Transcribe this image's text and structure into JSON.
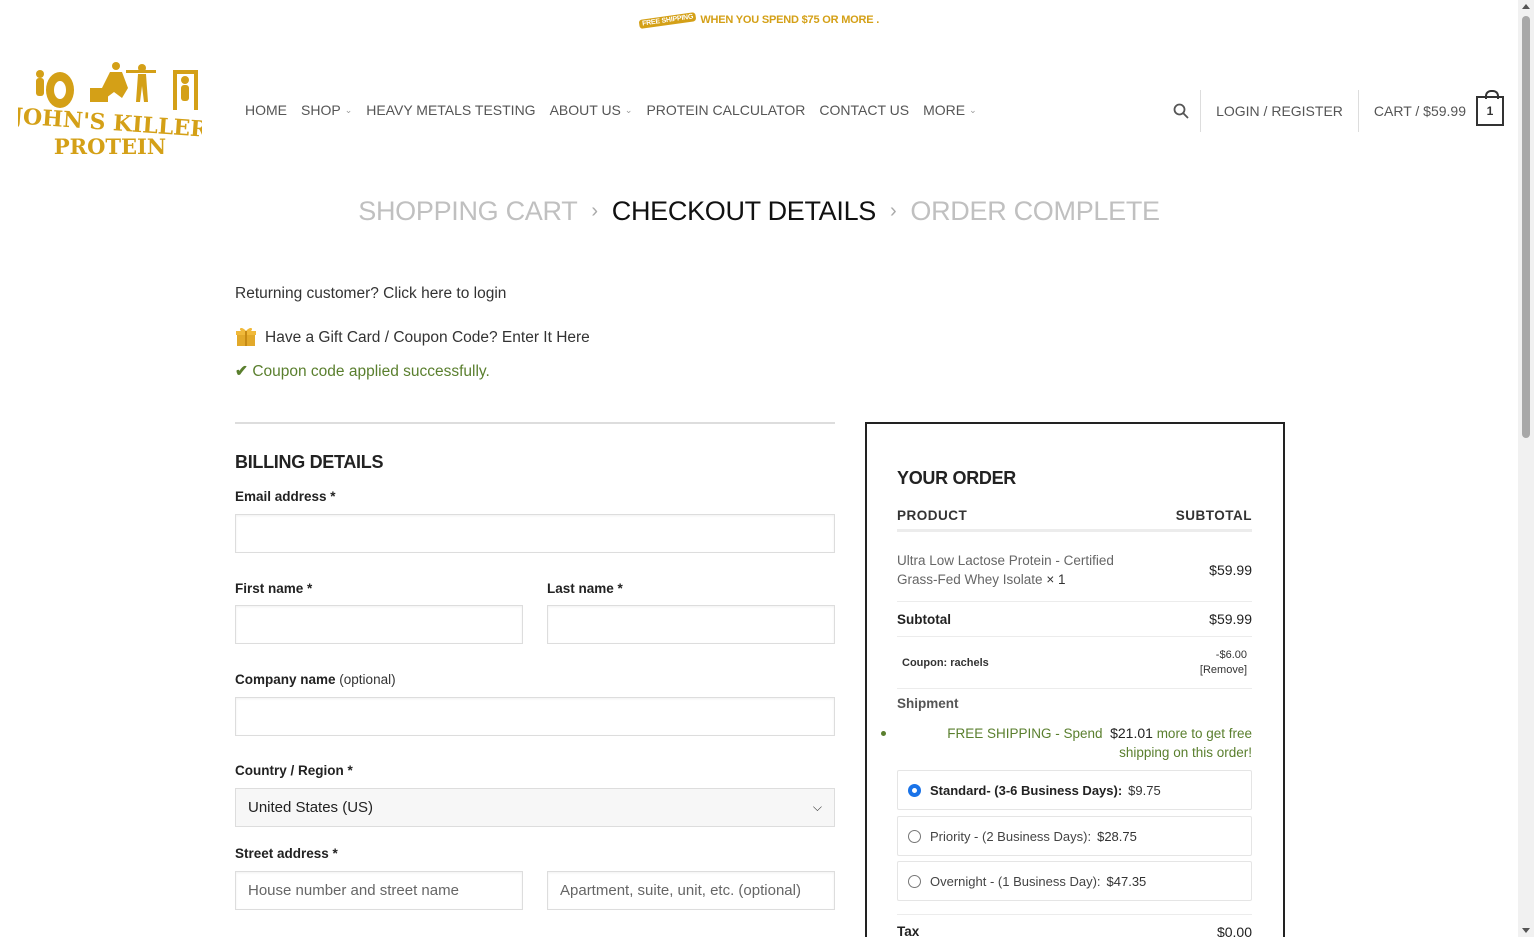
{
  "promo": {
    "badge": "FREE SHIPPING",
    "text": "WHEN YOU SPEND $75 OR MORE ."
  },
  "brand": {
    "line1": "JOHN'S KILLER",
    "line2": "PROTEIN",
    "color": "#d4a017"
  },
  "nav": {
    "items": [
      {
        "label": "HOME",
        "dropdown": false
      },
      {
        "label": "SHOP",
        "dropdown": true
      },
      {
        "label": "HEAVY METALS TESTING",
        "dropdown": false
      },
      {
        "label": "ABOUT US",
        "dropdown": true
      },
      {
        "label": "PROTEIN CALCULATOR",
        "dropdown": false
      },
      {
        "label": "CONTACT US",
        "dropdown": false
      },
      {
        "label": "MORE",
        "dropdown": true
      }
    ]
  },
  "header": {
    "login": "LOGIN / REGISTER",
    "cart": "CART / $59.99",
    "cart_count": "1"
  },
  "steps": {
    "cart": "SHOPPING CART",
    "checkout": "CHECKOUT DETAILS",
    "complete": "ORDER COMPLETE"
  },
  "notices": {
    "returning": "Returning customer? Click here to login",
    "coupon": "Have a Gift Card / Coupon Code? Enter It Here",
    "applied": "Coupon code applied successfully."
  },
  "billing": {
    "title": "BILLING DETAILS",
    "email_label": "Email address *",
    "first_label": "First name *",
    "last_label": "Last name *",
    "company_label": "Company name",
    "company_optional": "(optional)",
    "country_label": "Country / Region *",
    "country_value": "United States (US)",
    "street_label": "Street address *",
    "street_placeholder": "House number and street name",
    "apt_placeholder": "Apartment, suite, unit, etc. (optional)"
  },
  "order": {
    "title": "YOUR ORDER",
    "col_product": "PRODUCT",
    "col_subtotal": "SUBTOTAL",
    "product_line1": "Ultra Low Lactose Protein - Certified",
    "product_line2": "Grass-Fed Whey Isolate",
    "product_qty": "× 1",
    "product_price": "$59.99",
    "subtotal_label": "Subtotal",
    "subtotal_value": "$59.99",
    "coupon_label": "Coupon: rachels",
    "coupon_value": "-$6.00",
    "coupon_remove": "[Remove]",
    "shipment_label": "Shipment",
    "freeship_prefix": "FREE SHIPPING - Spend",
    "freeship_amount": "$21.01",
    "freeship_suffix1": "more to get free",
    "freeship_suffix2": "shipping on this order!",
    "shipping_options": [
      {
        "label": "Standard- (3-6 Business Days):",
        "price": "$9.75",
        "selected": true
      },
      {
        "label": "Priority - (2 Business Days):",
        "price": "$28.75",
        "selected": false
      },
      {
        "label": "Overnight - (1 Business Day):",
        "price": "$47.35",
        "selected": false
      }
    ],
    "tax_label": "Tax",
    "tax_value": "$0.00"
  },
  "colors": {
    "accent_gold": "#d4a017",
    "success_green": "#5a7f2e",
    "radio_blue": "#1a73e8"
  }
}
